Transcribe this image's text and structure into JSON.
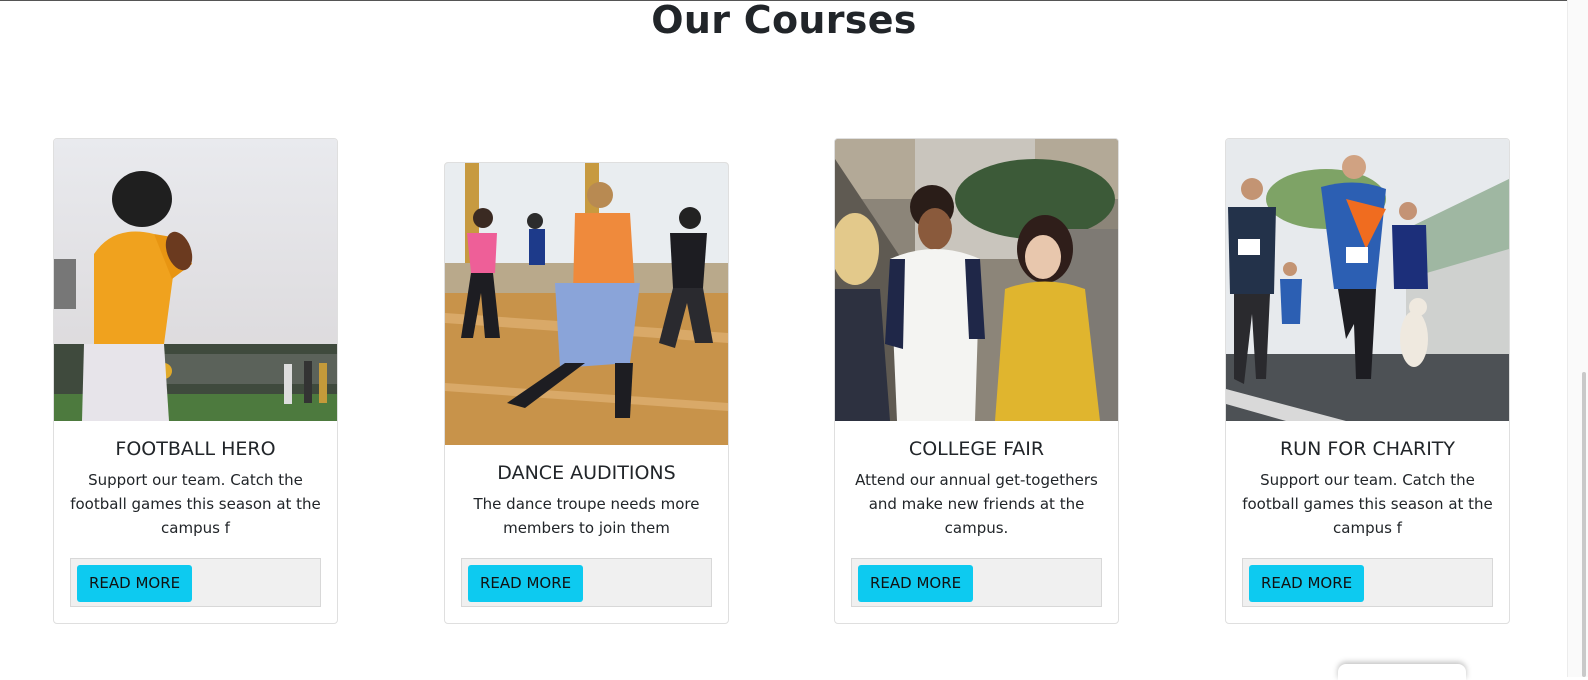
{
  "page": {
    "title": "Our Courses"
  },
  "cards": [
    {
      "title": "FOOTBALL HERO",
      "text": "Support our team. Catch the football games this season at the campus f",
      "button": "READ MORE",
      "image_icon": "football-player-photo"
    },
    {
      "title": "DANCE AUDITIONS",
      "text": "The dance troupe needs more members to join them",
      "button": "READ MORE",
      "image_icon": "dance-class-photo"
    },
    {
      "title": "COLLEGE FAIR",
      "text": "Attend our annual get-togethers and make new friends at the campus.",
      "button": "READ MORE",
      "image_icon": "students-talking-photo"
    },
    {
      "title": "RUN FOR CHARITY",
      "text": "Support our team. Catch the football games this season at the campus f",
      "button": "READ MORE",
      "image_icon": "charity-run-photo"
    }
  ],
  "colors": {
    "button": "#0dcaf0",
    "footer": "#f0f0f0",
    "text": "#212529"
  }
}
